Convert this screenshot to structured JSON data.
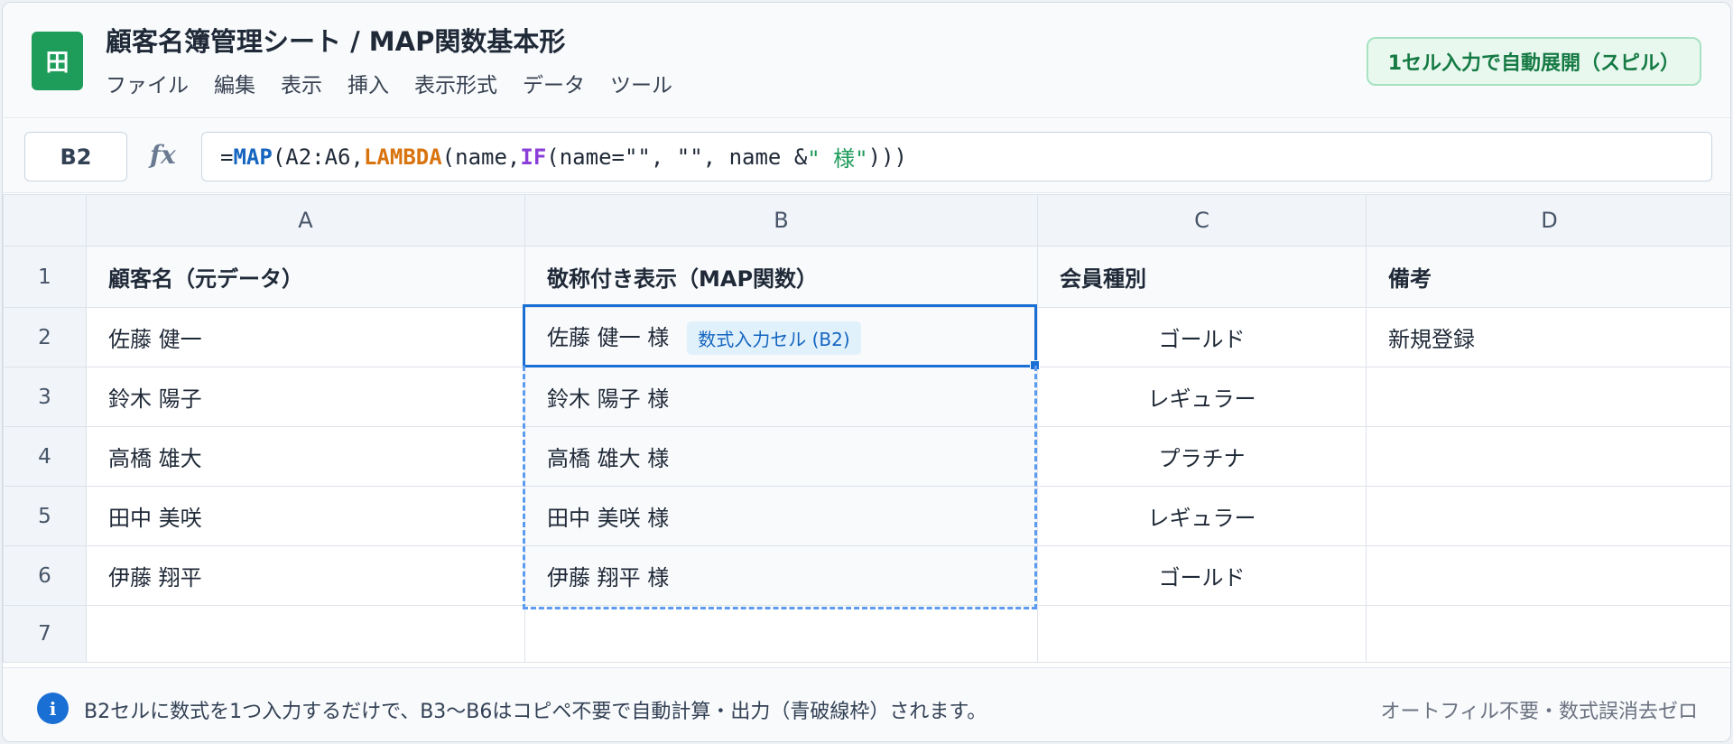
{
  "app": {
    "logo_glyph": "田",
    "title": "顧客名簿管理シート / MAP関数基本形",
    "menu": [
      "ファイル",
      "編集",
      "表示",
      "挿入",
      "表示形式",
      "データ",
      "ツール"
    ],
    "spill_badge": "1セル入力で自動展開（スピル）"
  },
  "formula_bar": {
    "name_box": "B2",
    "fx_label": "fx",
    "formula_tokens": {
      "t0": "=",
      "t1": "MAP",
      "t2": "(A2:A6,",
      "t3": "LAMBDA",
      "t4": "(name,",
      "t5": "IF",
      "t6": "(name=\"\", \"\", name &",
      "t7": "\" 様\"",
      "t8": ")))"
    }
  },
  "grid": {
    "columns": [
      "A",
      "B",
      "C",
      "D"
    ],
    "row_numbers": [
      "1",
      "2",
      "3",
      "4",
      "5",
      "6",
      "7"
    ],
    "header_row": [
      "顧客名（元データ）",
      "敬称付き表示（MAP関数）",
      "会員種別",
      "備考"
    ],
    "rows": [
      [
        "佐藤 健一",
        "佐藤 健一 様",
        "ゴールド",
        "新規登録"
      ],
      [
        "鈴木 陽子",
        "鈴木 陽子 様",
        "レギュラー",
        ""
      ],
      [
        "高橋 雄大",
        "高橋 雄大 様",
        "プラチナ",
        ""
      ],
      [
        "田中 美咲",
        "田中 美咲 様",
        "レギュラー",
        ""
      ],
      [
        "伊藤 翔平",
        "伊藤 翔平 様",
        "ゴールド",
        ""
      ],
      [
        "",
        "",
        "",
        ""
      ]
    ],
    "formula_cell_tag": "数式入力セル (B2)"
  },
  "footer": {
    "info_glyph": "i",
    "note": "B2セルに数式を1つ入力するだけで、B3〜B6はコピペ不要で自動計算・出力（青破線枠）されます。",
    "right": "オートフィル不要・数式誤消去ゼロ"
  },
  "colors": {
    "brand_green": "#1e9c5a",
    "active_blue": "#1a6fd4",
    "spill_dashed": "#5b9cf0",
    "fn_map": "#1565c0",
    "fn_lambda": "#d9730d",
    "fn_if": "#8b3fd9",
    "string": "#1e9c5a"
  }
}
